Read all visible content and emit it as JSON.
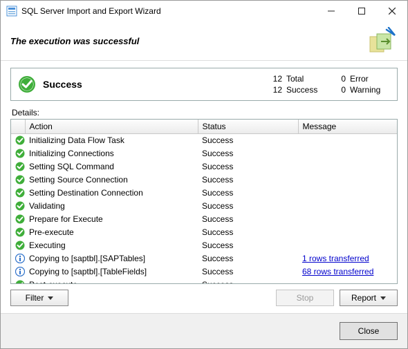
{
  "window": {
    "title": "SQL Server Import and Export Wizard"
  },
  "header": {
    "title": "The execution was successful"
  },
  "summary": {
    "label": "Success",
    "total_n": "12",
    "total_l": "Total",
    "error_n": "0",
    "error_l": "Error",
    "success_n": "12",
    "success_l": "Success",
    "warning_n": "0",
    "warning_l": "Warning"
  },
  "details_label": "Details:",
  "columns": {
    "action": "Action",
    "status": "Status",
    "message": "Message"
  },
  "rows": [
    {
      "icon": "check",
      "action": "Initializing Data Flow Task",
      "status": "Success",
      "message": ""
    },
    {
      "icon": "check",
      "action": "Initializing Connections",
      "status": "Success",
      "message": ""
    },
    {
      "icon": "check",
      "action": "Setting SQL Command",
      "status": "Success",
      "message": ""
    },
    {
      "icon": "check",
      "action": "Setting Source Connection",
      "status": "Success",
      "message": ""
    },
    {
      "icon": "check",
      "action": "Setting Destination Connection",
      "status": "Success",
      "message": ""
    },
    {
      "icon": "check",
      "action": "Validating",
      "status": "Success",
      "message": ""
    },
    {
      "icon": "check",
      "action": "Prepare for Execute",
      "status": "Success",
      "message": ""
    },
    {
      "icon": "check",
      "action": "Pre-execute",
      "status": "Success",
      "message": ""
    },
    {
      "icon": "check",
      "action": "Executing",
      "status": "Success",
      "message": ""
    },
    {
      "icon": "info",
      "action": "Copying to [saptbl].[SAPTables]",
      "status": "Success",
      "message": "1 rows transferred",
      "link": true
    },
    {
      "icon": "info",
      "action": "Copying to [saptbl].[TableFields]",
      "status": "Success",
      "message": "68 rows transferred",
      "link": true
    },
    {
      "icon": "check",
      "action": "Post-execute",
      "status": "Success",
      "message": ""
    }
  ],
  "buttons": {
    "filter": "Filter",
    "stop": "Stop",
    "report": "Report",
    "close": "Close"
  }
}
